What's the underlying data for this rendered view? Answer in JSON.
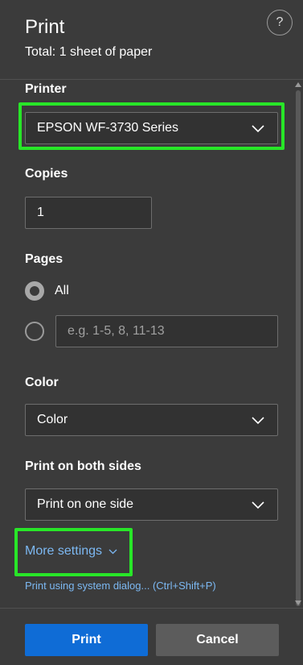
{
  "header": {
    "title": "Print",
    "subtitle": "Total: 1 sheet of paper",
    "help_label": "?"
  },
  "printer": {
    "label": "Printer",
    "value": "EPSON WF-3730 Series"
  },
  "copies": {
    "label": "Copies",
    "value": "1"
  },
  "pages": {
    "label": "Pages",
    "option_all": "All",
    "custom_placeholder": "e.g. 1-5, 8, 11-13"
  },
  "color": {
    "label": "Color",
    "value": "Color"
  },
  "duplex": {
    "label": "Print on both sides",
    "value": "Print on one side"
  },
  "links": {
    "more_settings": "More settings",
    "system_dialog": "Print using system dialog... (Ctrl+Shift+P)"
  },
  "footer": {
    "print_label": "Print",
    "cancel_label": "Cancel"
  },
  "colors": {
    "background": "#3b3b3b",
    "primary_button": "#0f6cd6",
    "link": "#7cb8f2",
    "highlight": "#28e628"
  }
}
